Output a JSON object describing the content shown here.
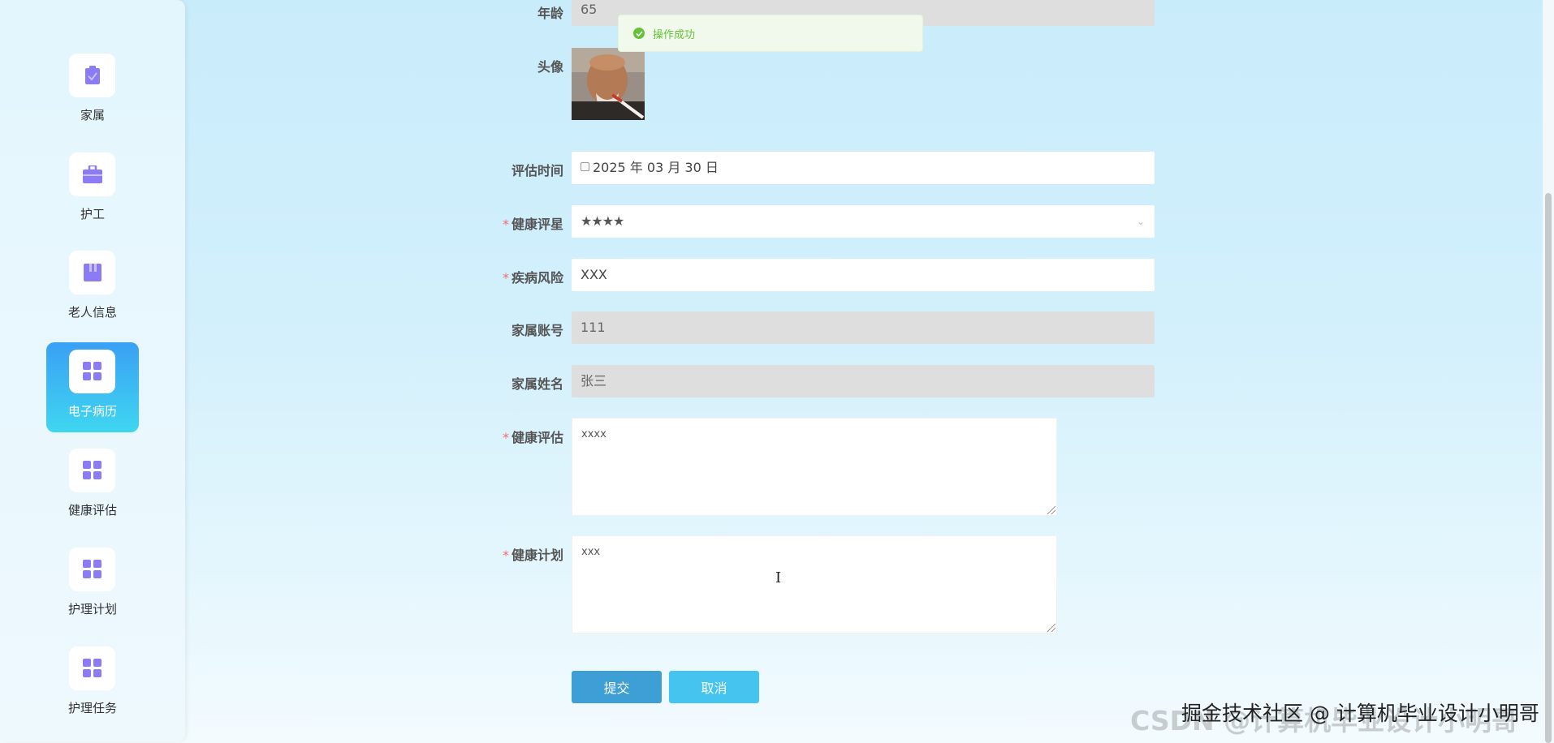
{
  "sidebar": {
    "items": [
      {
        "label": "家属",
        "icon": "clipboard-check-icon"
      },
      {
        "label": "护工",
        "icon": "briefcase-icon"
      },
      {
        "label": "老人信息",
        "icon": "book-icon"
      },
      {
        "label": "电子病历",
        "icon": "grid-icon",
        "active": true
      },
      {
        "label": "健康评估",
        "icon": "grid-icon"
      },
      {
        "label": "护理计划",
        "icon": "grid-icon"
      },
      {
        "label": "护理任务",
        "icon": "grid-icon"
      }
    ]
  },
  "form": {
    "age": {
      "label": "年龄",
      "value": "65"
    },
    "avatar": {
      "label": "头像"
    },
    "eval_time": {
      "label": "评估时间",
      "value": "2025 年 03 月 30 日"
    },
    "health_stars": {
      "label": "健康评星",
      "value": "★★★★",
      "required": true
    },
    "disease_risk": {
      "label": "疾病风险",
      "value": "XXX",
      "required": true
    },
    "family_account": {
      "label": "家属账号",
      "value": "111"
    },
    "family_name": {
      "label": "家属姓名",
      "value": "张三"
    },
    "health_eval": {
      "label": "健康评估",
      "value": "xxxx",
      "required": true
    },
    "health_plan": {
      "label": "健康计划",
      "value": "xxx",
      "required": true
    }
  },
  "buttons": {
    "submit": "提交",
    "cancel": "取消"
  },
  "toast": {
    "message": "操作成功"
  },
  "watermark": {
    "back": "CSDN @计算机毕业设计小明哥",
    "front": "掘金技术社区 @ 计算机毕业设计小明哥"
  },
  "colors": {
    "accent": "#3aa0f5",
    "submit": "#3d9fd6",
    "cancel": "#45c4f0",
    "success": "#67c23a",
    "required": "#f56c6c",
    "icon": "#8b7cf6"
  }
}
